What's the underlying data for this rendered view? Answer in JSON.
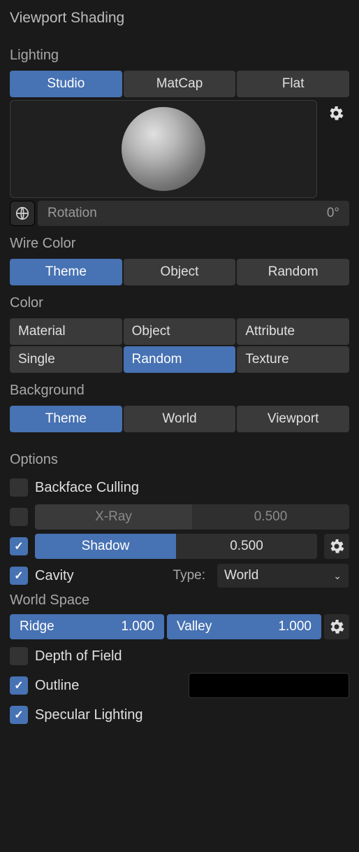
{
  "title": "Viewport Shading",
  "lighting": {
    "label": "Lighting",
    "tabs": [
      "Studio",
      "MatCap",
      "Flat"
    ],
    "active": 0,
    "rotation_label": "Rotation",
    "rotation_value": "0°"
  },
  "wire_color": {
    "label": "Wire Color",
    "tabs": [
      "Theme",
      "Object",
      "Random"
    ],
    "active": 0
  },
  "color": {
    "label": "Color",
    "cells": [
      "Material",
      "Object",
      "Attribute",
      "Single",
      "Random",
      "Texture"
    ],
    "active": 4
  },
  "background": {
    "label": "Background",
    "tabs": [
      "Theme",
      "World",
      "Viewport"
    ],
    "active": 0
  },
  "options": {
    "label": "Options",
    "backface_culling": {
      "label": "Backface Culling",
      "checked": false
    },
    "xray": {
      "label": "X-Ray",
      "checked": false,
      "value": "0.500"
    },
    "shadow": {
      "label": "Shadow",
      "checked": true,
      "value": "0.500"
    },
    "cavity": {
      "label": "Cavity",
      "checked": true,
      "type_label": "Type:",
      "type_value": "World"
    },
    "world_space": {
      "label": "World Space",
      "ridge_label": "Ridge",
      "ridge_value": "1.000",
      "valley_label": "Valley",
      "valley_value": "1.000"
    },
    "depth_of_field": {
      "label": "Depth of Field",
      "checked": false
    },
    "outline": {
      "label": "Outline",
      "checked": true,
      "color": "#000000"
    },
    "specular": {
      "label": "Specular Lighting",
      "checked": true
    }
  }
}
